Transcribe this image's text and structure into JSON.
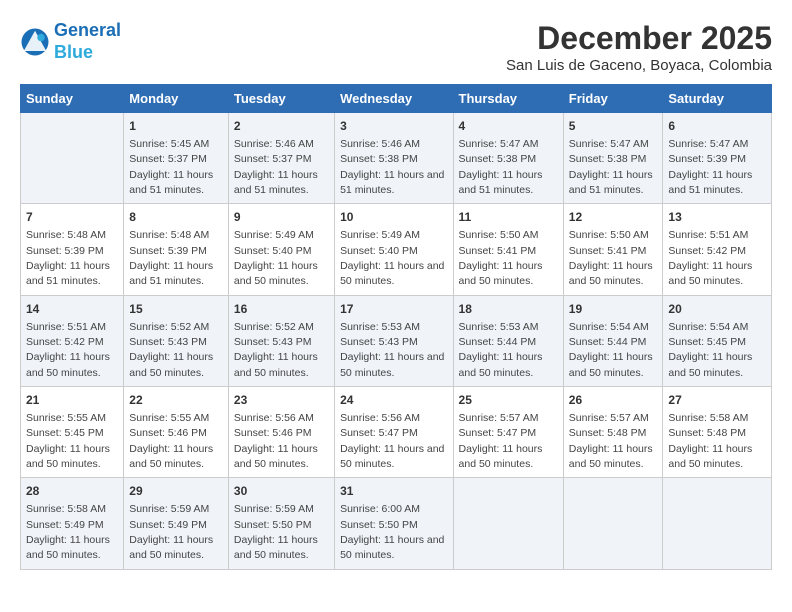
{
  "logo": {
    "line1": "General",
    "line2": "Blue"
  },
  "title": "December 2025",
  "subtitle": "San Luis de Gaceno, Boyaca, Colombia",
  "days_header": [
    "Sunday",
    "Monday",
    "Tuesday",
    "Wednesday",
    "Thursday",
    "Friday",
    "Saturday"
  ],
  "weeks": [
    [
      {
        "num": "",
        "sunrise": "",
        "sunset": "",
        "daylight": ""
      },
      {
        "num": "1",
        "sunrise": "Sunrise: 5:45 AM",
        "sunset": "Sunset: 5:37 PM",
        "daylight": "Daylight: 11 hours and 51 minutes."
      },
      {
        "num": "2",
        "sunrise": "Sunrise: 5:46 AM",
        "sunset": "Sunset: 5:37 PM",
        "daylight": "Daylight: 11 hours and 51 minutes."
      },
      {
        "num": "3",
        "sunrise": "Sunrise: 5:46 AM",
        "sunset": "Sunset: 5:38 PM",
        "daylight": "Daylight: 11 hours and 51 minutes."
      },
      {
        "num": "4",
        "sunrise": "Sunrise: 5:47 AM",
        "sunset": "Sunset: 5:38 PM",
        "daylight": "Daylight: 11 hours and 51 minutes."
      },
      {
        "num": "5",
        "sunrise": "Sunrise: 5:47 AM",
        "sunset": "Sunset: 5:38 PM",
        "daylight": "Daylight: 11 hours and 51 minutes."
      },
      {
        "num": "6",
        "sunrise": "Sunrise: 5:47 AM",
        "sunset": "Sunset: 5:39 PM",
        "daylight": "Daylight: 11 hours and 51 minutes."
      }
    ],
    [
      {
        "num": "7",
        "sunrise": "Sunrise: 5:48 AM",
        "sunset": "Sunset: 5:39 PM",
        "daylight": "Daylight: 11 hours and 51 minutes."
      },
      {
        "num": "8",
        "sunrise": "Sunrise: 5:48 AM",
        "sunset": "Sunset: 5:39 PM",
        "daylight": "Daylight: 11 hours and 51 minutes."
      },
      {
        "num": "9",
        "sunrise": "Sunrise: 5:49 AM",
        "sunset": "Sunset: 5:40 PM",
        "daylight": "Daylight: 11 hours and 50 minutes."
      },
      {
        "num": "10",
        "sunrise": "Sunrise: 5:49 AM",
        "sunset": "Sunset: 5:40 PM",
        "daylight": "Daylight: 11 hours and 50 minutes."
      },
      {
        "num": "11",
        "sunrise": "Sunrise: 5:50 AM",
        "sunset": "Sunset: 5:41 PM",
        "daylight": "Daylight: 11 hours and 50 minutes."
      },
      {
        "num": "12",
        "sunrise": "Sunrise: 5:50 AM",
        "sunset": "Sunset: 5:41 PM",
        "daylight": "Daylight: 11 hours and 50 minutes."
      },
      {
        "num": "13",
        "sunrise": "Sunrise: 5:51 AM",
        "sunset": "Sunset: 5:42 PM",
        "daylight": "Daylight: 11 hours and 50 minutes."
      }
    ],
    [
      {
        "num": "14",
        "sunrise": "Sunrise: 5:51 AM",
        "sunset": "Sunset: 5:42 PM",
        "daylight": "Daylight: 11 hours and 50 minutes."
      },
      {
        "num": "15",
        "sunrise": "Sunrise: 5:52 AM",
        "sunset": "Sunset: 5:43 PM",
        "daylight": "Daylight: 11 hours and 50 minutes."
      },
      {
        "num": "16",
        "sunrise": "Sunrise: 5:52 AM",
        "sunset": "Sunset: 5:43 PM",
        "daylight": "Daylight: 11 hours and 50 minutes."
      },
      {
        "num": "17",
        "sunrise": "Sunrise: 5:53 AM",
        "sunset": "Sunset: 5:43 PM",
        "daylight": "Daylight: 11 hours and 50 minutes."
      },
      {
        "num": "18",
        "sunrise": "Sunrise: 5:53 AM",
        "sunset": "Sunset: 5:44 PM",
        "daylight": "Daylight: 11 hours and 50 minutes."
      },
      {
        "num": "19",
        "sunrise": "Sunrise: 5:54 AM",
        "sunset": "Sunset: 5:44 PM",
        "daylight": "Daylight: 11 hours and 50 minutes."
      },
      {
        "num": "20",
        "sunrise": "Sunrise: 5:54 AM",
        "sunset": "Sunset: 5:45 PM",
        "daylight": "Daylight: 11 hours and 50 minutes."
      }
    ],
    [
      {
        "num": "21",
        "sunrise": "Sunrise: 5:55 AM",
        "sunset": "Sunset: 5:45 PM",
        "daylight": "Daylight: 11 hours and 50 minutes."
      },
      {
        "num": "22",
        "sunrise": "Sunrise: 5:55 AM",
        "sunset": "Sunset: 5:46 PM",
        "daylight": "Daylight: 11 hours and 50 minutes."
      },
      {
        "num": "23",
        "sunrise": "Sunrise: 5:56 AM",
        "sunset": "Sunset: 5:46 PM",
        "daylight": "Daylight: 11 hours and 50 minutes."
      },
      {
        "num": "24",
        "sunrise": "Sunrise: 5:56 AM",
        "sunset": "Sunset: 5:47 PM",
        "daylight": "Daylight: 11 hours and 50 minutes."
      },
      {
        "num": "25",
        "sunrise": "Sunrise: 5:57 AM",
        "sunset": "Sunset: 5:47 PM",
        "daylight": "Daylight: 11 hours and 50 minutes."
      },
      {
        "num": "26",
        "sunrise": "Sunrise: 5:57 AM",
        "sunset": "Sunset: 5:48 PM",
        "daylight": "Daylight: 11 hours and 50 minutes."
      },
      {
        "num": "27",
        "sunrise": "Sunrise: 5:58 AM",
        "sunset": "Sunset: 5:48 PM",
        "daylight": "Daylight: 11 hours and 50 minutes."
      }
    ],
    [
      {
        "num": "28",
        "sunrise": "Sunrise: 5:58 AM",
        "sunset": "Sunset: 5:49 PM",
        "daylight": "Daylight: 11 hours and 50 minutes."
      },
      {
        "num": "29",
        "sunrise": "Sunrise: 5:59 AM",
        "sunset": "Sunset: 5:49 PM",
        "daylight": "Daylight: 11 hours and 50 minutes."
      },
      {
        "num": "30",
        "sunrise": "Sunrise: 5:59 AM",
        "sunset": "Sunset: 5:50 PM",
        "daylight": "Daylight: 11 hours and 50 minutes."
      },
      {
        "num": "31",
        "sunrise": "Sunrise: 6:00 AM",
        "sunset": "Sunset: 5:50 PM",
        "daylight": "Daylight: 11 hours and 50 minutes."
      },
      {
        "num": "",
        "sunrise": "",
        "sunset": "",
        "daylight": ""
      },
      {
        "num": "",
        "sunrise": "",
        "sunset": "",
        "daylight": ""
      },
      {
        "num": "",
        "sunrise": "",
        "sunset": "",
        "daylight": ""
      }
    ]
  ]
}
